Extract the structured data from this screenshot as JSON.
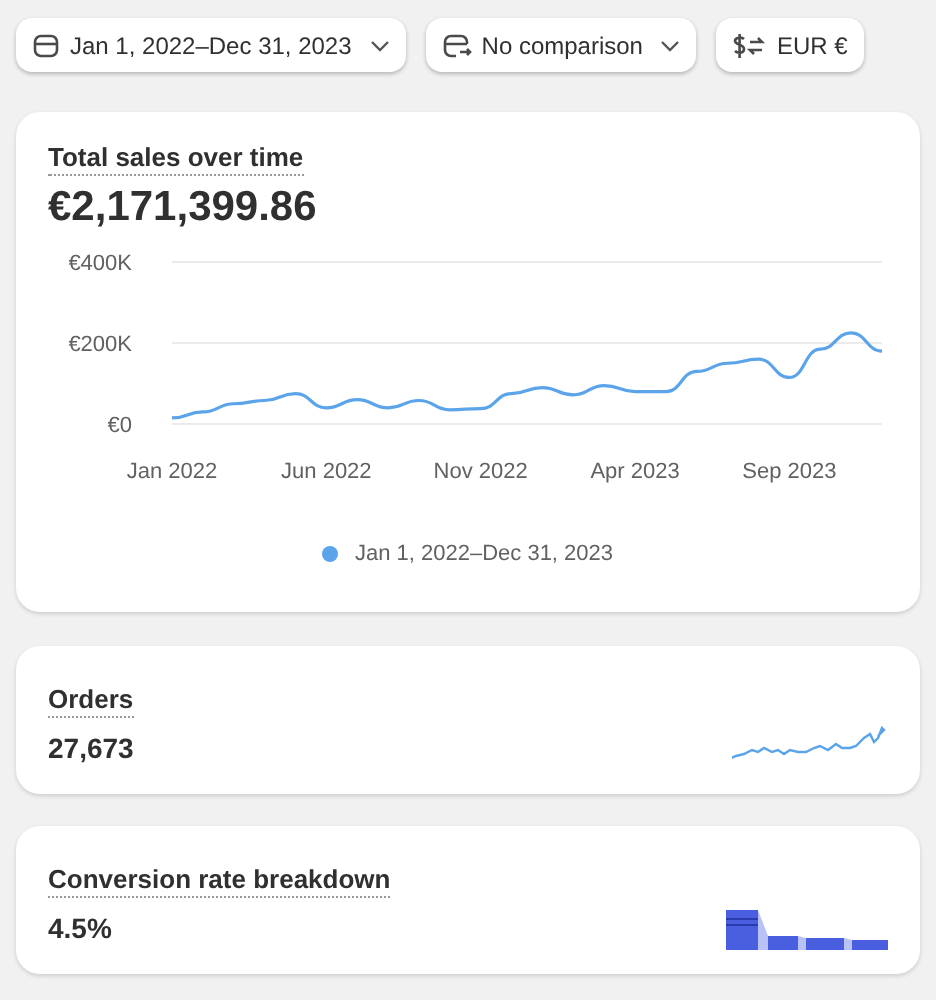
{
  "filters": [
    {
      "kind": "date",
      "label": "Jan 1, 2022–Dec 31, 2023",
      "dropdown": true
    },
    {
      "kind": "comparison",
      "label": "No comparison",
      "dropdown": true
    },
    {
      "kind": "currency",
      "label": "EUR €",
      "dropdown": false
    }
  ],
  "sales_card": {
    "title": "Total sales over time",
    "value": "€2,171,399.86",
    "chart_data": {
      "type": "line",
      "categories": [
        "Jan 2022",
        null,
        null,
        null,
        null,
        "Jun 2022",
        null,
        null,
        null,
        null,
        "Nov 2022",
        null,
        null,
        null,
        null,
        "Apr 2023",
        null,
        null,
        null,
        null,
        "Sep 2023",
        null,
        null,
        null
      ],
      "series": [
        {
          "name": "Jan 1, 2022–Dec 31, 2023",
          "color": "#5ba4ea",
          "values": [
            15,
            30,
            50,
            58,
            75,
            40,
            60,
            40,
            58,
            35,
            38,
            75,
            90,
            72,
            95,
            80,
            80,
            130,
            150,
            160,
            115,
            185,
            225,
            180
          ]
        }
      ],
      "ylim": [
        0,
        400
      ],
      "yticks": [
        {
          "value": 0,
          "label": "€0"
        },
        {
          "value": 200,
          "label": "€200K"
        },
        {
          "value": 400,
          "label": "€400K"
        }
      ]
    }
  },
  "metric_cards": [
    {
      "kind": "sparkline",
      "title": "Orders",
      "value": "27,673"
    },
    {
      "kind": "bars",
      "title": "Conversion rate breakdown",
      "value": "4.5%"
    }
  ]
}
